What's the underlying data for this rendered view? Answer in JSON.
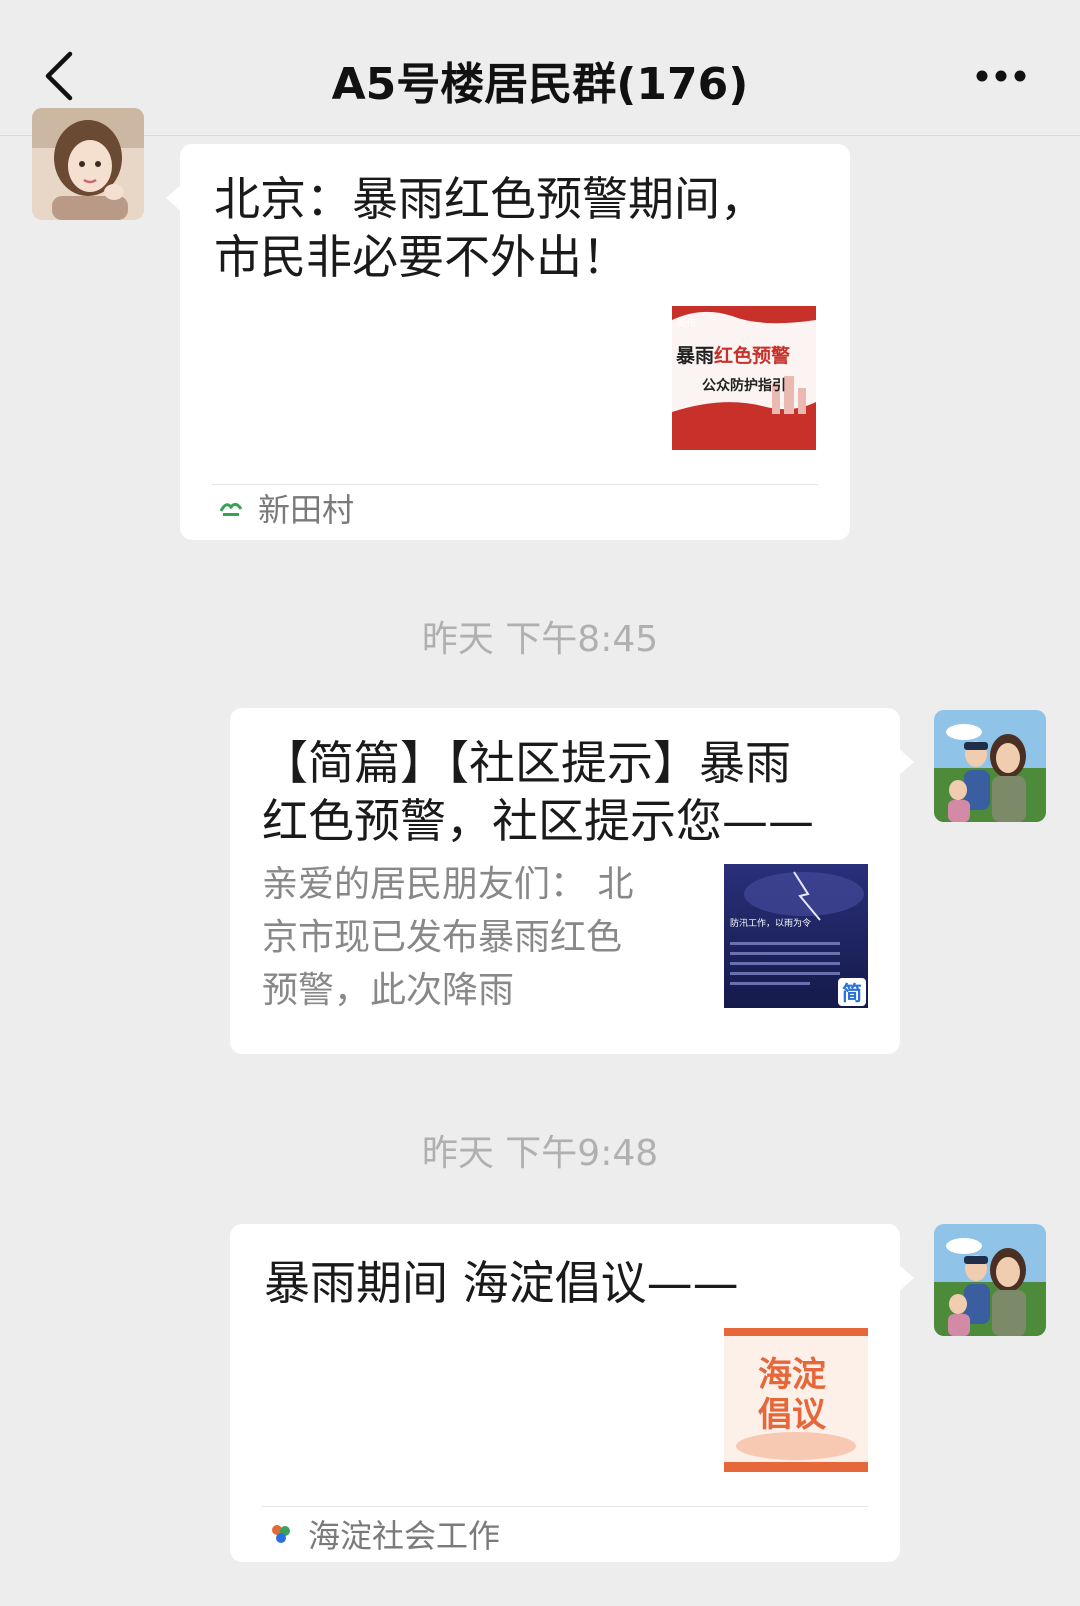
{
  "header": {
    "title": "A5号楼居民群(176)"
  },
  "messages": [
    {
      "title": "北京：暴雨红色预警期间，市民非必要不外出！",
      "title_lines": [
        "北京：暴雨红色预警期间，",
        "市民非必要不外出！"
      ],
      "thumbnail": {
        "tag": "发布",
        "line1_a": "暴雨",
        "line1_b": "红色预警",
        "line2": "公众防护指引"
      },
      "source": "新田村"
    },
    {
      "title_lines": [
        "【简篇】【社区提示】暴雨",
        "红色预警，社区提示您——"
      ],
      "desc_lines": [
        "亲爱的居民朋友们： 北",
        "京市现已发布暴雨红色",
        "预警，此次降雨"
      ],
      "thumbnail": {
        "headline": "防汛工作，以雨为令",
        "badge": "简"
      }
    },
    {
      "title_lines": [
        "暴雨期间 海淀倡议——"
      ],
      "thumbnail": {
        "line1": "海淀",
        "line2": "倡议"
      },
      "source": "海淀社会工作"
    }
  ],
  "timestamps": [
    "昨天 下午8:45",
    "昨天 下午9:48"
  ],
  "colors": {
    "background": "#ededed",
    "card": "#ffffff",
    "accent_red": "#c8302a",
    "accent_orange": "#e5673a"
  }
}
